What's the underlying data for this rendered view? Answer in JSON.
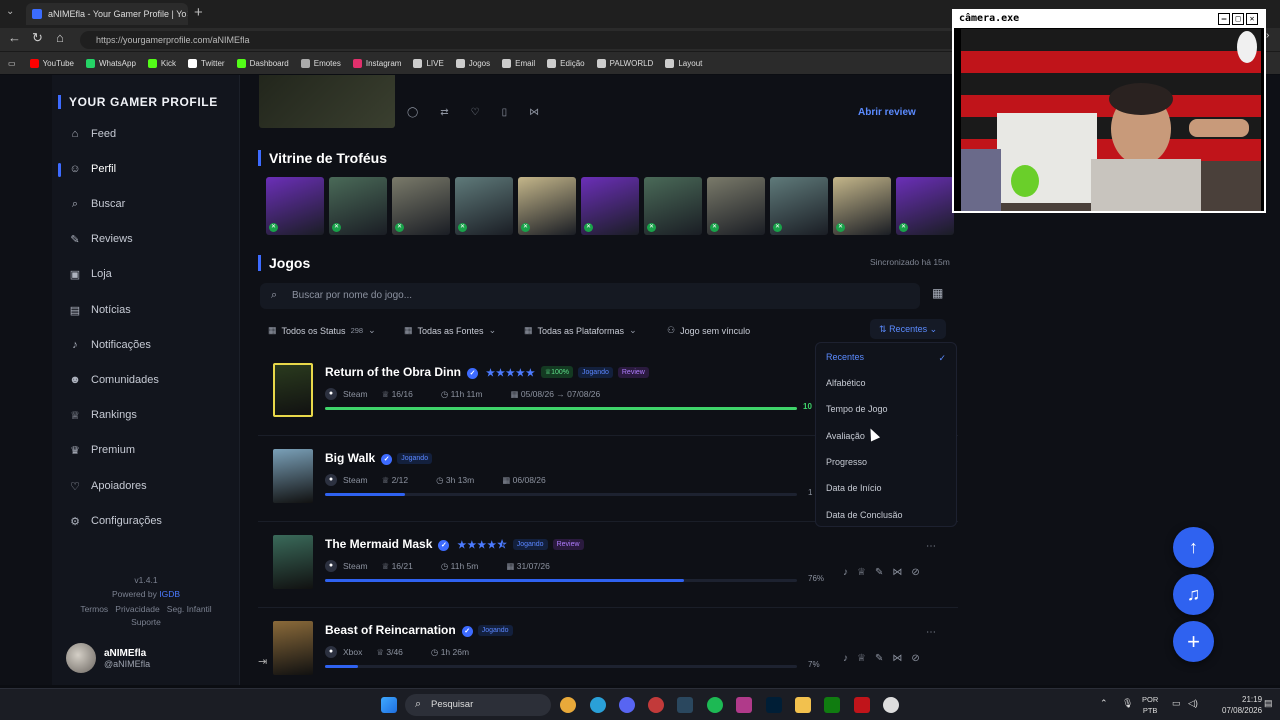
{
  "browser": {
    "tab_title": "aNIMEfla - Your Gamer Profile | Yo",
    "url": "https://yourgamerprofile.com/aNIMEfla",
    "bookmarks": [
      {
        "label": "YouTube",
        "color": "#ff0000"
      },
      {
        "label": "WhatsApp",
        "color": "#25d366"
      },
      {
        "label": "Kick",
        "color": "#53fc18"
      },
      {
        "label": "Twitter",
        "color": "#ffffff"
      },
      {
        "label": "Dashboard",
        "color": "#53fc18"
      },
      {
        "label": "Emotes",
        "color": "#aaaaaa"
      },
      {
        "label": "Instagram",
        "color": "#e1306c"
      },
      {
        "label": "LIVE",
        "color": "#cccccc"
      },
      {
        "label": "Jogos",
        "color": "#cccccc"
      },
      {
        "label": "Email",
        "color": "#cccccc"
      },
      {
        "label": "Edição",
        "color": "#cccccc"
      },
      {
        "label": "PALWORLD",
        "color": "#cccccc"
      },
      {
        "label": "Layout",
        "color": "#cccccc"
      }
    ]
  },
  "sidebar": {
    "brand": "YOUR GAMER PROFILE",
    "items": [
      {
        "label": "Feed",
        "icon": "home-icon",
        "glyph": "⌂"
      },
      {
        "label": "Perfil",
        "icon": "user-icon",
        "glyph": "☺",
        "active": true
      },
      {
        "label": "Buscar",
        "icon": "search-icon",
        "glyph": "⌕"
      },
      {
        "label": "Reviews",
        "icon": "pen-icon",
        "glyph": "✎"
      },
      {
        "label": "Loja",
        "icon": "store-icon",
        "glyph": "▣"
      },
      {
        "label": "Notícias",
        "icon": "newspaper-icon",
        "glyph": "▤"
      },
      {
        "label": "Notificações",
        "icon": "bell-icon",
        "glyph": "♪"
      },
      {
        "label": "Comunidades",
        "icon": "users-icon",
        "glyph": "☻"
      },
      {
        "label": "Rankings",
        "icon": "trophy-icon",
        "glyph": "♕"
      },
      {
        "label": "Premium",
        "icon": "crown-icon",
        "glyph": "♛"
      },
      {
        "label": "Apoiadores",
        "icon": "heart-icon",
        "glyph": "♡"
      },
      {
        "label": "Configurações",
        "icon": "gear-icon",
        "glyph": "⚙"
      }
    ],
    "version": "v1.4.1",
    "powered_prefix": "Powered by",
    "powered_link": "IGDB",
    "footer_links": [
      "Termos",
      "Privacidade",
      "Seg. Infantil",
      "Suporte"
    ],
    "user": {
      "name": "aNIMEfla",
      "handle": "@aNIMEfla"
    }
  },
  "review_bar": {
    "open_review": "Abrir review"
  },
  "trophies": {
    "title": "Vitrine de Troféus",
    "items": [
      {
        "color": "#6b2fb8"
      },
      {
        "color": "#4a6a58"
      },
      {
        "color": "#7a7a6a"
      },
      {
        "color": "#5f7a7a"
      },
      {
        "color": "#c4b68a"
      },
      {
        "color": "#6b2fb8"
      },
      {
        "color": "#4a6a58"
      },
      {
        "color": "#7a7a6a"
      },
      {
        "color": "#5f7a7a"
      },
      {
        "color": "#c4b68a"
      },
      {
        "color": "#6b2fb8"
      }
    ]
  },
  "games": {
    "title": "Jogos",
    "synced": "Sincronizado há 15m",
    "search_placeholder": "Buscar por nome do jogo...",
    "filters": {
      "status": "Todos os Status",
      "status_count": "298",
      "sources": "Todas as Fontes",
      "platforms": "Todas as Plataformas",
      "unlinked": "Jogo sem vínculo"
    },
    "sort": {
      "label": "Recentes",
      "options": [
        "Recentes",
        "Alfabético",
        "Tempo de Jogo",
        "Avaliação",
        "Progresso",
        "Data de Início",
        "Data de Conclusão"
      ],
      "selected": "Recentes"
    },
    "list": [
      {
        "title": "Return of the Obra Dinn",
        "stars": "★★★★★",
        "badges": [
          {
            "text": "♕100%",
            "kind": "green"
          },
          {
            "text": "Jogando",
            "kind": "blue"
          },
          {
            "text": "Review",
            "kind": "purple"
          }
        ],
        "platform": "Steam",
        "achievements": "16/16",
        "playtime": "11h 11m",
        "dates": "05/08/26 → 07/08/26",
        "progress": 100,
        "progress_label": "10",
        "bar_color": "#3fd46a",
        "cover": "#2a3a1e"
      },
      {
        "title": "Big Walk",
        "stars": "",
        "badges": [
          {
            "text": "Jogando",
            "kind": "blue"
          }
        ],
        "platform": "Steam",
        "achievements": "2/12",
        "playtime": "3h 13m",
        "dates": "06/08/26",
        "progress": 17,
        "progress_label": "1",
        "bar_color": "#2f62f0",
        "cover": "#7aa0b8"
      },
      {
        "title": "The Mermaid Mask",
        "stars": "★★★★⯪",
        "badges": [
          {
            "text": "Jogando",
            "kind": "blue"
          },
          {
            "text": "Review",
            "kind": "purple"
          }
        ],
        "platform": "Steam",
        "achievements": "16/21",
        "playtime": "11h 5m",
        "dates": "31/07/26",
        "progress": 76,
        "progress_label": "76%",
        "bar_color": "#2f62f0",
        "cover": "#3a6a5a"
      },
      {
        "title": "Beast of Reincarnation",
        "stars": "",
        "badges": [
          {
            "text": "Jogando",
            "kind": "blue"
          }
        ],
        "platform": "Xbox",
        "achievements": "3/46",
        "playtime": "1h 26m",
        "dates": "",
        "progress": 7,
        "progress_label": "7%",
        "bar_color": "#2f62f0",
        "cover": "#8a6a3a"
      }
    ]
  },
  "camera": {
    "title": "câmera.exe"
  },
  "taskbar": {
    "search": "Pesquisar",
    "lang": "POR",
    "layout": "PTB",
    "time": "21:19",
    "date": "07/08/2026"
  }
}
